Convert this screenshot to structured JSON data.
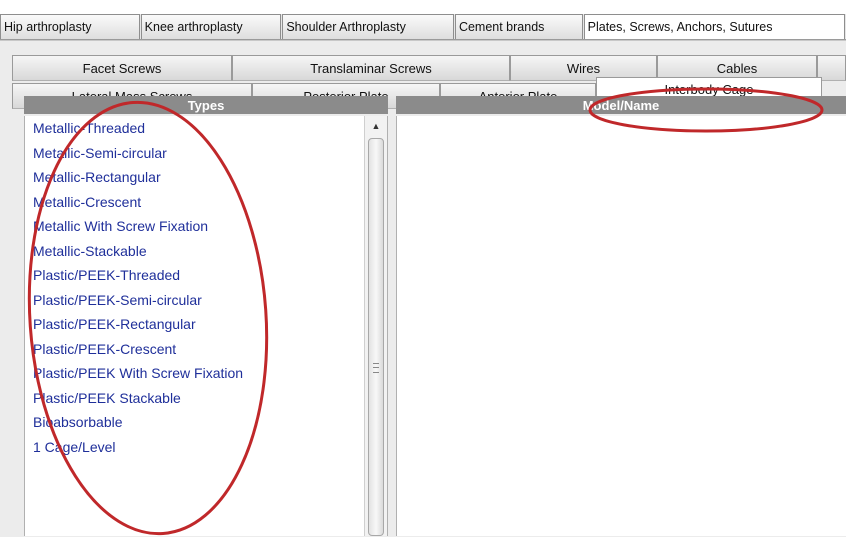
{
  "top_tabs": [
    {
      "label": "Hip arthroplasty",
      "active": false
    },
    {
      "label": "Knee arthroplasty",
      "active": false
    },
    {
      "label": "Shoulder Arthroplasty",
      "active": false
    },
    {
      "label": "Cement brands",
      "active": false
    },
    {
      "label": "Plates, Screws, Anchors, Sutures",
      "active": true
    }
  ],
  "sub_tabs_row1": [
    "Facet Screws",
    "Translaminar Screws",
    "Wires",
    "Cables",
    ""
  ],
  "sub_tabs_row2": [
    "Lateral Mass Screws",
    "Posterior Plate",
    "Anterior Plate",
    "Interbody Cage"
  ],
  "active_sub_tab": "Interbody Cage",
  "types_panel": {
    "header": "Types",
    "items": [
      "Metallic-Threaded",
      "Metallic-Semi-circular",
      "Metallic-Rectangular",
      "Metallic-Crescent",
      "Metallic With Screw Fixation",
      "Metallic-Stackable",
      "Plastic/PEEK-Threaded",
      "Plastic/PEEK-Semi-circular",
      "Plastic/PEEK-Rectangular",
      "Plastic/PEEK-Crescent",
      "Plastic/PEEK With Screw Fixation",
      "Plastic/PEEK Stackable",
      "Bioabsorbable",
      "1 Cage/Level"
    ]
  },
  "model_panel": {
    "header": "Model/Name"
  },
  "icons": {
    "scroll_up": "triangle-up-icon",
    "scroll_grip": "grip-icon"
  },
  "colors": {
    "annotation": "#c0282a",
    "list_text": "#1f2f9a",
    "header_bg": "#8b8b8b"
  }
}
